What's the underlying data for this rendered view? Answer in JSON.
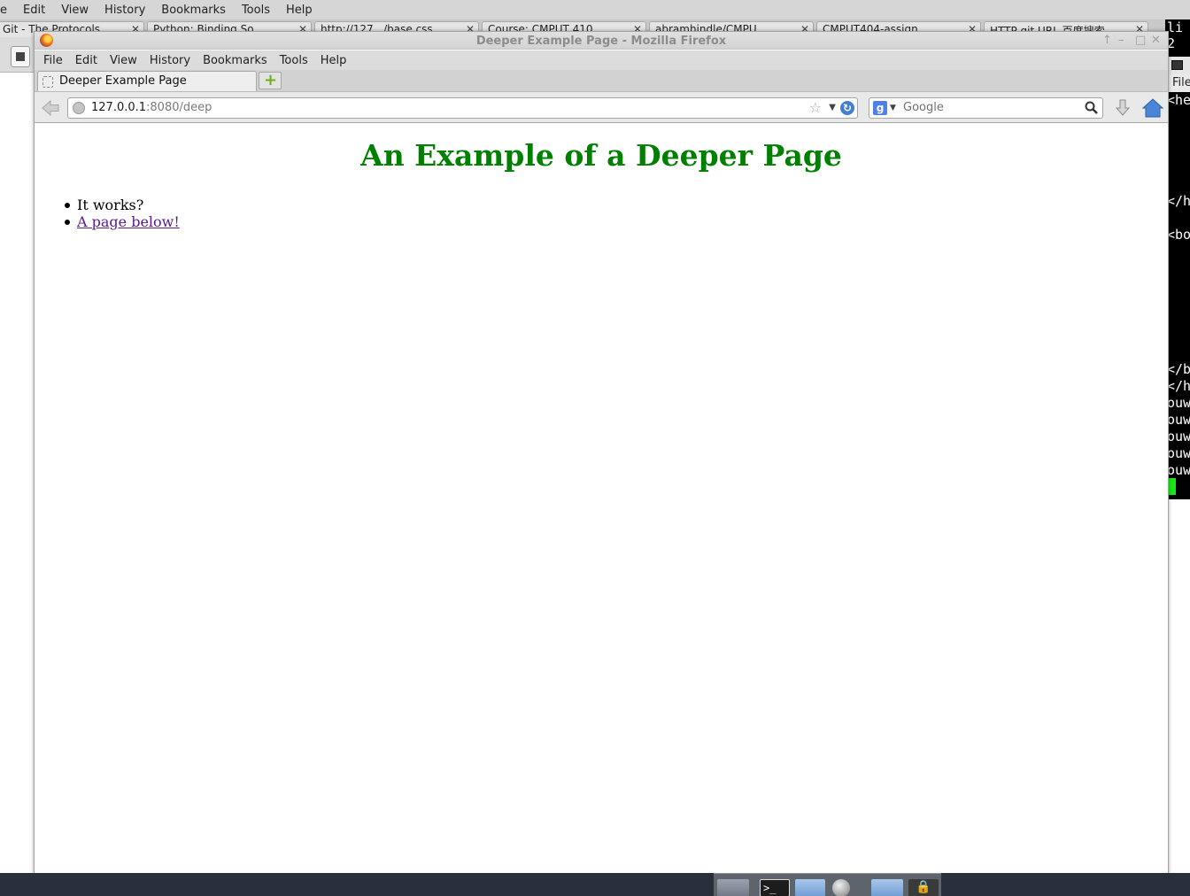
{
  "background_browser": {
    "menu": [
      "e",
      "Edit",
      "View",
      "History",
      "Bookmarks",
      "Tools",
      "Help"
    ],
    "tabs": [
      "Git - The Protocols",
      "Python: Binding So...",
      "http://127.../base.css",
      "Course: CMPUT 410...",
      "abramhindle/CMPU...",
      "CMPUT404-assign...",
      "HTTP git URL 百度搜索"
    ]
  },
  "terminal": {
    "menu_label": "File",
    "top_fragments": [
      "li",
      "2"
    ],
    "lines": [
      "<he",
      "</h",
      "<bo",
      "</b",
      "</h",
      "ouw",
      "ouw",
      "ouw",
      "ouw",
      "ouw"
    ]
  },
  "window": {
    "title": "Deeper Example Page - Mozilla Firefox",
    "controls": [
      "↑",
      "–",
      "□",
      "✕"
    ]
  },
  "menubar": {
    "file": "File",
    "edit": "Edit",
    "view": "View",
    "history": "History",
    "bookmarks": "Bookmarks",
    "tools": "Tools",
    "help": "Help"
  },
  "tab": {
    "label": "Deeper Example Page",
    "new_tab_glyph": "+"
  },
  "navbar": {
    "url_host": "127.0.0.1",
    "url_rest": ":8080/deep",
    "search_engine_glyph": "g",
    "search_placeholder": "Google"
  },
  "page": {
    "heading": "An Example of a Deeper Page",
    "items": [
      {
        "text": "It works?"
      },
      {
        "link_text": "A page below!"
      }
    ]
  },
  "colors": {
    "heading": "#008000",
    "visited_link": "#551a8b",
    "terminal_cursor": "#19e619",
    "taskbar": "#27303b"
  }
}
